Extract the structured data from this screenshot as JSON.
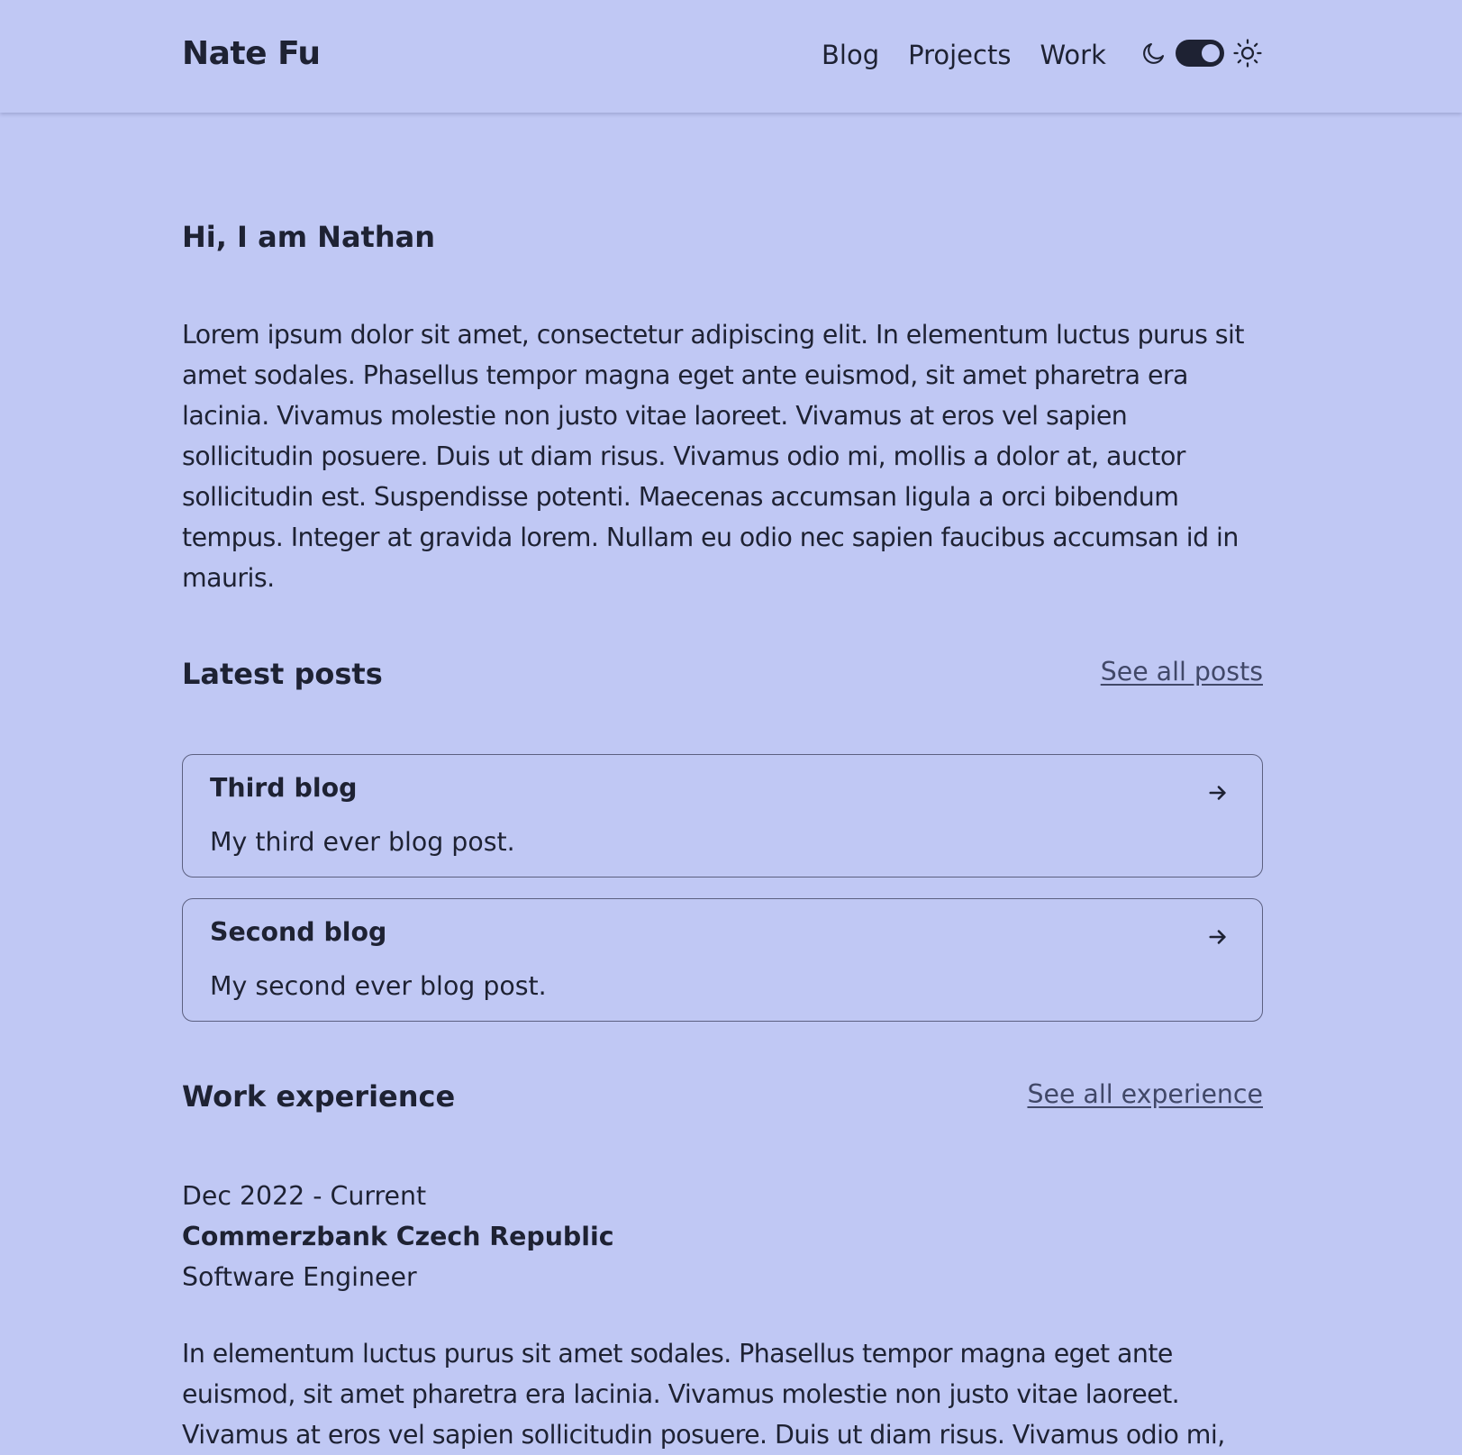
{
  "header": {
    "brand": "Nate Fu",
    "nav": [
      {
        "label": "Blog"
      },
      {
        "label": "Projects"
      },
      {
        "label": "Work"
      }
    ],
    "theme_toggle": {
      "left_icon": "moon-icon",
      "right_icon": "sun-icon",
      "state": "light"
    }
  },
  "hero": {
    "greeting": "Hi, I am Nathan",
    "intro": "Lorem ipsum dolor sit amet, consectetur adipiscing elit. In elementum luctus purus sit amet sodales. Phasellus tempor magna eget ante euismod, sit amet pharetra era lacinia. Vivamus molestie non justo vitae laoreet. Vivamus at eros vel sapien sollicitudin posuere. Duis ut diam risus. Vivamus odio mi, mollis a dolor at, auctor sollicitudin est. Suspendisse potenti. Maecenas accumsan ligula a orci bibendum tempus. Integer at gravida lorem. Nullam eu odio nec sapien faucibus accumsan id in mauris."
  },
  "posts": {
    "title": "Latest posts",
    "see_all": "See all posts",
    "items": [
      {
        "title": "Third blog",
        "description": "My third ever blog post.",
        "icon": "arrow-right-icon"
      },
      {
        "title": "Second blog",
        "description": "My second ever blog post.",
        "icon": "arrow-right-icon"
      }
    ]
  },
  "work": {
    "title": "Work experience",
    "see_all": "See all experience",
    "items": [
      {
        "dates": "Dec 2022 - Current",
        "company": "Commerzbank Czech Republic",
        "role": "Software Engineer",
        "description": "In elementum luctus purus sit amet sodales. Phasellus tempor magna eget ante euismod, sit amet pharetra era lacinia. Vivamus molestie non justo vitae laoreet. Vivamus at eros vel sapien sollicitudin posuere. Duis ut diam risus. Vivamus odio mi,"
      }
    ]
  },
  "colors": {
    "background": "#c0c8f4",
    "text": "#1e2233",
    "link": "#414868",
    "border": "#5c6080"
  }
}
